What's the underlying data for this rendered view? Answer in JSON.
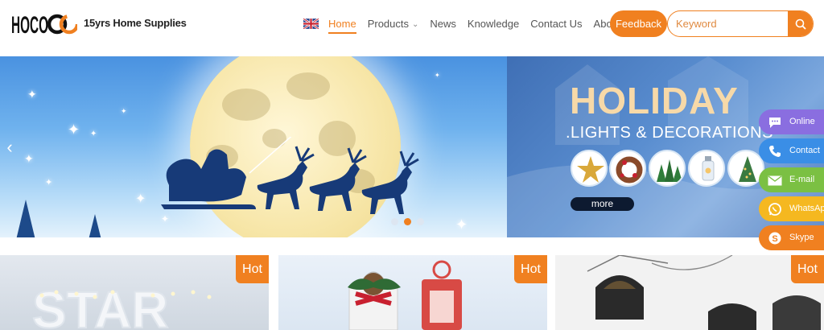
{
  "header": {
    "logo_text": "HOCO",
    "tagline": "15yrs Home Supplies",
    "nav": [
      {
        "label": "Home",
        "active": true
      },
      {
        "label": "Products",
        "has_dropdown": true
      },
      {
        "label": "News"
      },
      {
        "label": "Knowledge"
      },
      {
        "label": "Contact Us"
      },
      {
        "label": "About Us"
      }
    ],
    "feedback_label": "Feedback",
    "search_placeholder": "Keyword"
  },
  "banner": {
    "title": "HOLIDAY",
    "subtitle": ".LIGHTS & DECORATIONS",
    "more_label": "more",
    "active_slide": 2,
    "slide_count": 3
  },
  "side_contacts": [
    {
      "label": "Online",
      "icon": "chat-bubble-icon",
      "color": "#8a6ee0"
    },
    {
      "label": "Contact",
      "icon": "phone-icon",
      "color": "#3a8ee6"
    },
    {
      "label": "E-mail",
      "icon": "mail-icon",
      "color": "#7bc043"
    },
    {
      "label": "WhatsApp",
      "icon": "whatsapp-icon",
      "color": "#f5b820"
    },
    {
      "label": "Skype",
      "icon": "skype-icon",
      "color": "#f08020"
    }
  ],
  "products": [
    {
      "badge": "Hot"
    },
    {
      "badge": "Hot"
    },
    {
      "badge": "Hot"
    }
  ],
  "colors": {
    "accent": "#f08020",
    "text": "#555555"
  }
}
